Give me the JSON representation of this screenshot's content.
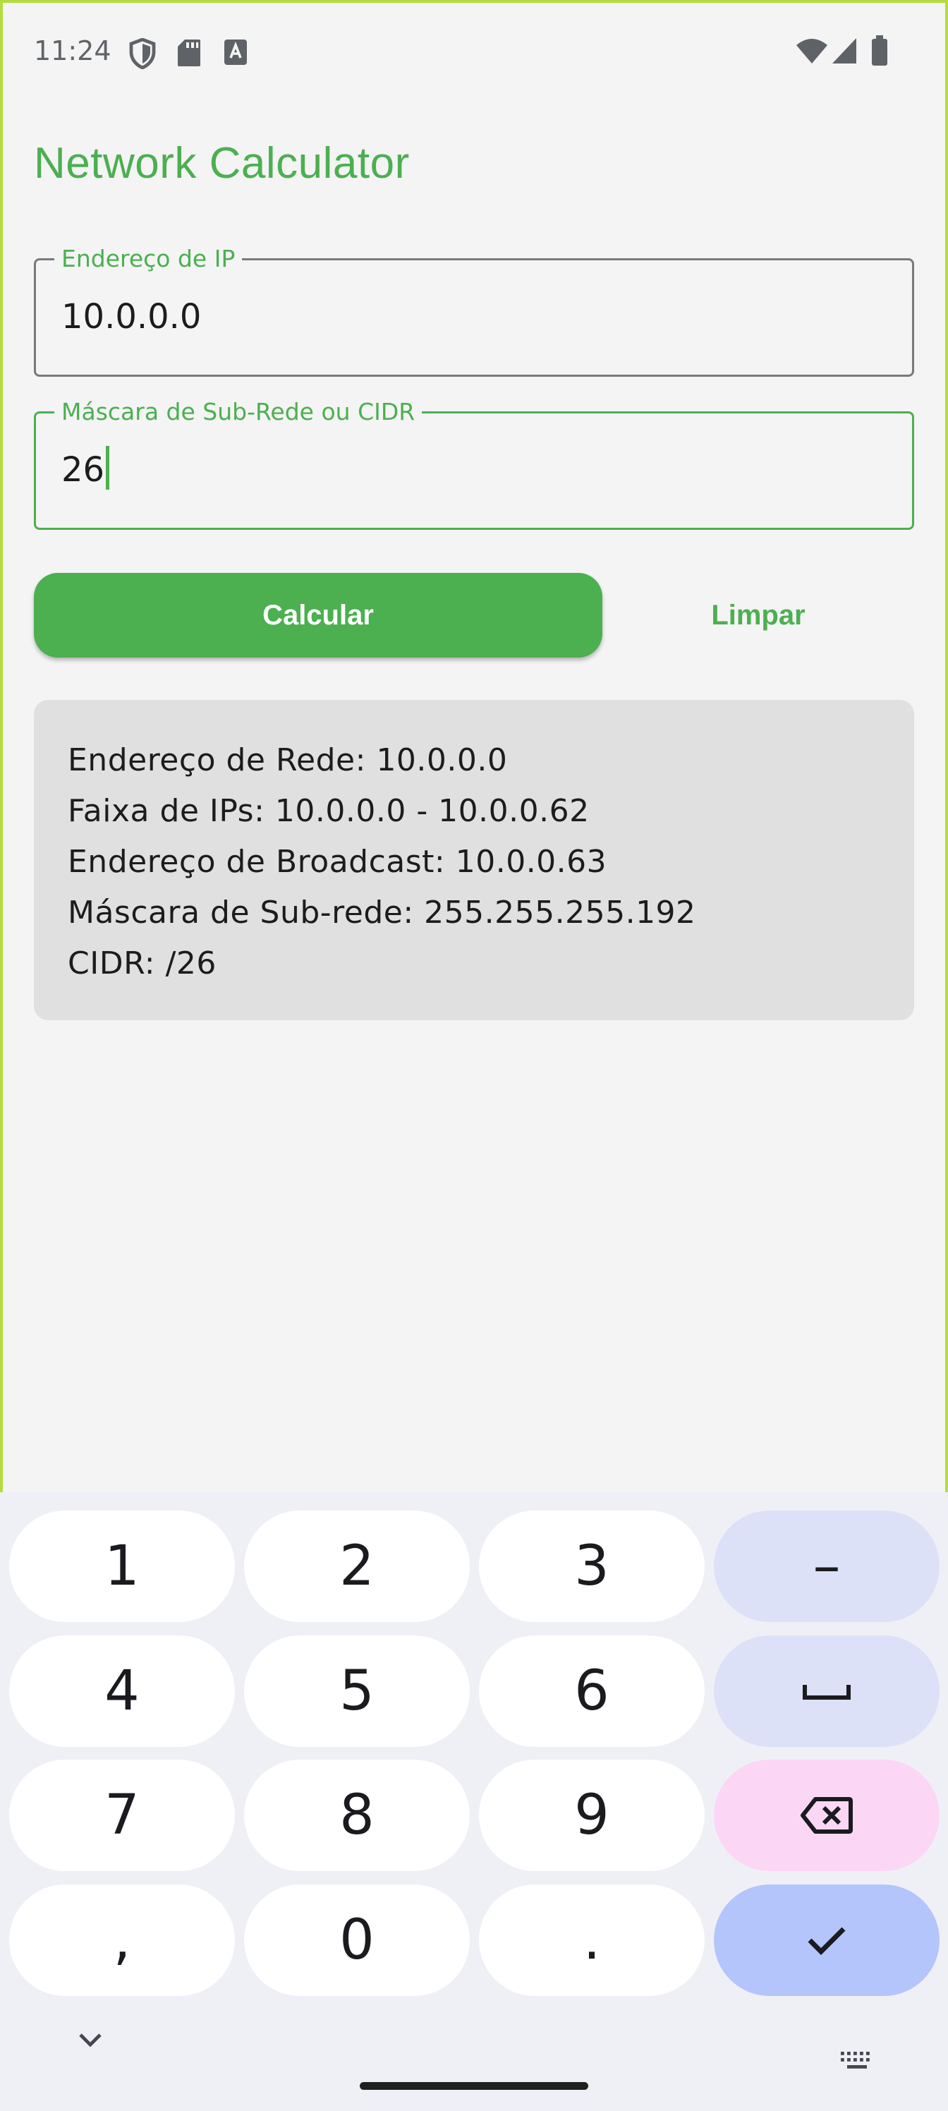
{
  "status_bar": {
    "time": "11:24",
    "icons_left": [
      "shield-icon",
      "sd-card-icon",
      "keyboard-a-icon"
    ],
    "icons_right": [
      "wifi-icon",
      "cellular-icon",
      "battery-icon"
    ]
  },
  "app": {
    "title": "Network Calculator",
    "accent_color": "#4caf50"
  },
  "form": {
    "ip_field": {
      "label": "Endereço de IP",
      "value": "10.0.0.0"
    },
    "mask_field": {
      "label": "Máscara de Sub-Rede ou CIDR",
      "value": "26",
      "focused": true
    },
    "calculate_label": "Calcular",
    "clear_label": "Limpar"
  },
  "results": {
    "lines": [
      "Endereço de Rede: 10.0.0.0",
      "Faixa de IPs: 10.0.0.0 - 10.0.0.62",
      "Endereço de Broadcast: 10.0.0.63",
      "Máscara de Sub-rede: 255.255.255.192",
      "CIDR: /26"
    ]
  },
  "keyboard": {
    "rows": [
      [
        "1",
        "2",
        "3",
        "–"
      ],
      [
        "4",
        "5",
        "6",
        "space"
      ],
      [
        "7",
        "8",
        "9",
        "backspace"
      ],
      [
        ",",
        "0",
        ".",
        "done"
      ]
    ],
    "keys": {
      "k1": "1",
      "k2": "2",
      "k3": "3",
      "minus": "–",
      "k4": "4",
      "k5": "5",
      "k6": "6",
      "k7": "7",
      "k8": "8",
      "k9": "9",
      "comma": ",",
      "k0": "0",
      "period": "."
    }
  }
}
